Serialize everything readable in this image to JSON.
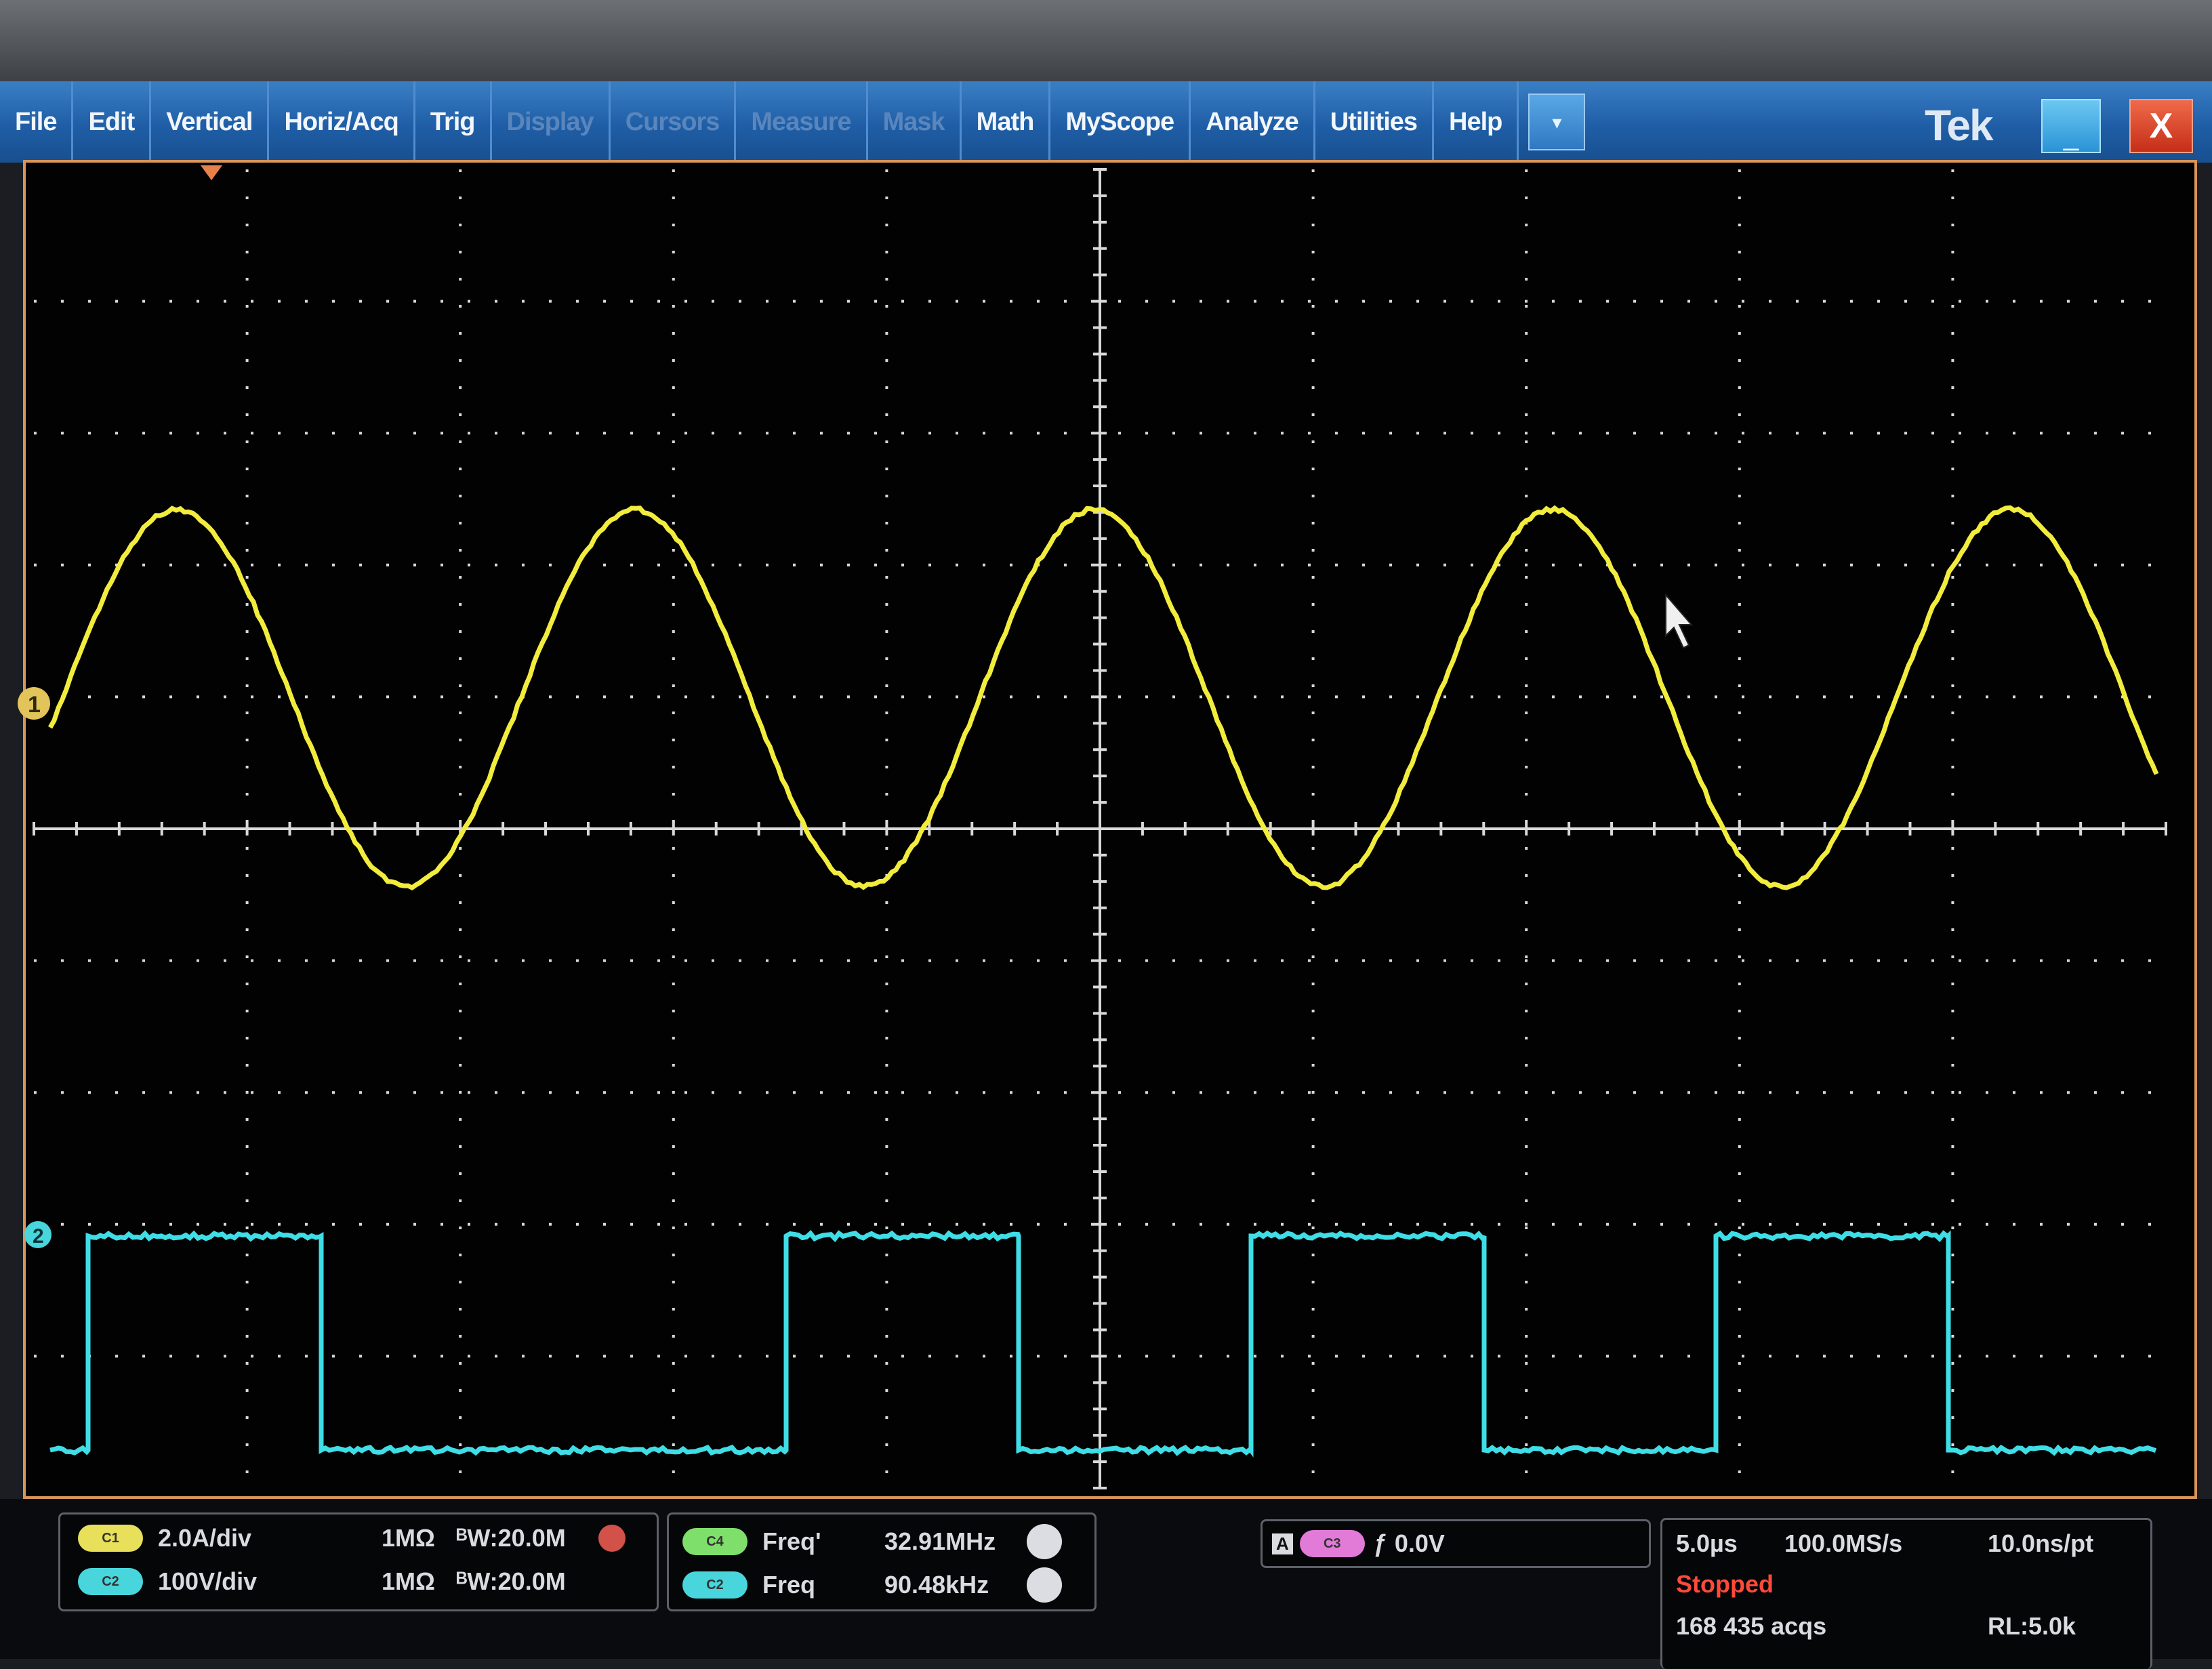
{
  "menu": {
    "items": [
      "File",
      "Edit",
      "Vertical",
      "Horiz/Acq",
      "Trig",
      "Display",
      "Cursors",
      "Measure",
      "Mask",
      "Math",
      "MyScope",
      "Analyze",
      "Utilities",
      "Help"
    ],
    "faded_items": [
      "Display",
      "Cursors",
      "Measure",
      "Mask"
    ],
    "dropdown_symbol": "▾"
  },
  "window": {
    "brand": "Tek",
    "minimize_symbol": "_",
    "close_symbol": "X"
  },
  "display": {
    "horizontal_divisions": 10,
    "vertical_divisions": 10,
    "ch1_color": "#f2ec3c",
    "ch2_color": "#3fdde6",
    "grid_color": "#d8d8d8",
    "ch1_marker": "1",
    "ch2_marker": "2",
    "cursor_icon": "arrow-pointer-icon"
  },
  "channels": {
    "ch1": {
      "pill": "C1",
      "scale": "2.0A/div",
      "impedance": "1MΩ",
      "bandwidth": "ᴮW:20.0M"
    },
    "ch2": {
      "pill": "C2",
      "scale": "100V/div",
      "impedance": "1MΩ",
      "bandwidth": "ᴮW:20.0M"
    }
  },
  "measurements": [
    {
      "pill": "C4",
      "label": "Freq'",
      "value": "32.91MHz"
    },
    {
      "pill": "C2",
      "label": "Freq",
      "value": "90.48kHz"
    }
  ],
  "trigger": {
    "source_pill": "C3",
    "prefix": "A",
    "slope_symbol": "ƒ",
    "level": "0.0V"
  },
  "acquisition": {
    "time_per_div": "5.0µs",
    "sample_rate": "100.0MS/s",
    "resolution": "10.0ns/pt",
    "state": "Stopped",
    "acqs": "168 435 acqs",
    "record_length": "RL:5.0k"
  }
}
